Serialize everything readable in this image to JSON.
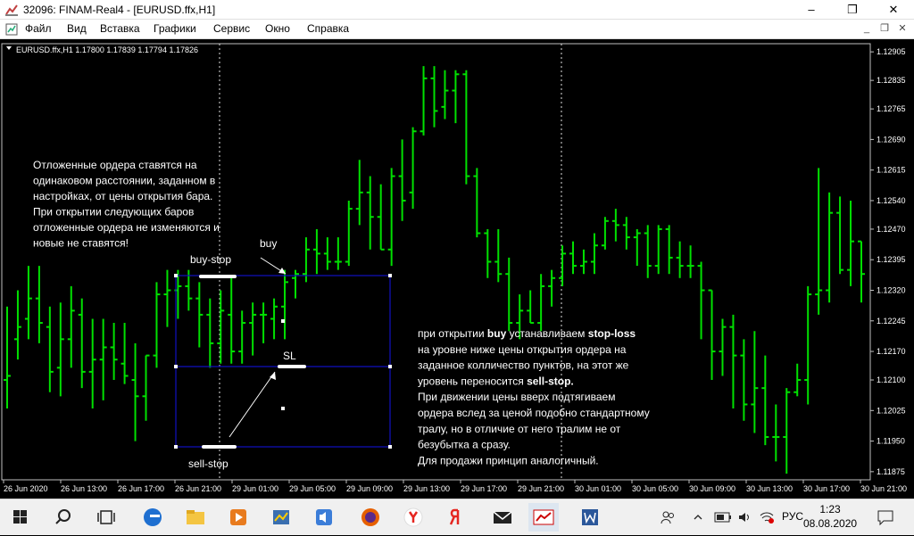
{
  "window": {
    "title": "32096: FINAM-Real4 - [EURUSD.ffx,H1]",
    "minimize": "–",
    "maximize": "❐",
    "close": "✕"
  },
  "menu": [
    "Файл",
    "Вид",
    "Вставка",
    "Графики",
    "Сервис",
    "Окно",
    "Справка"
  ],
  "mdi": {
    "minimize": "_",
    "restore": "❐",
    "close": "✕"
  },
  "chart": {
    "header": "EURUSD.ffx,H1  1.17800 1.17839 1.17794 1.17826",
    "price_labels": [
      "1.12905",
      "1.12835",
      "1.12765",
      "1.12690",
      "1.12615",
      "1.12540",
      "1.12470",
      "1.12395",
      "1.12320",
      "1.12245",
      "1.12170",
      "1.12100",
      "1.12025",
      "1.11950",
      "1.11875"
    ],
    "time_labels": [
      "26 Jun 2020",
      "26 Jun 13:00",
      "26 Jun 17:00",
      "26 Jun 21:00",
      "29 Jun 01:00",
      "29 Jun 05:00",
      "29 Jun 09:00",
      "29 Jun 13:00",
      "29 Jun 17:00",
      "29 Jun 21:00",
      "30 Jun 01:00",
      "30 Jun 05:00",
      "30 Jun 09:00",
      "30 Jun 13:00",
      "30 Jun 17:00",
      "30 Jun 21:00"
    ],
    "annotations": {
      "note_left": [
        "Отложенные ордера ставятся на",
        "одинаковом расстоянии, заданном в",
        "настройках,  от цены открытия бара.",
        "При открытии следующих баров",
        "отложенные ордера не изменяются и",
        "новые не ставятся!"
      ],
      "buy_stop": "buy-stop",
      "buy": "buy",
      "sl": "SL",
      "sell_stop": "sell-stop",
      "note_right": [
        [
          {
            "t": "при открытии "
          },
          {
            "t": "buy",
            "b": true
          },
          {
            "t": " устанавливаем "
          },
          {
            "t": "stop-loss",
            "b": true
          }
        ],
        [
          {
            "t": "на уровне ниже цены открытия ордера на"
          }
        ],
        [
          {
            "t": "заданное колличество пунктов, на этот же"
          }
        ],
        [
          {
            "t": "уровень переносится "
          },
          {
            "t": "sell-stop.",
            "b": true
          }
        ],
        [
          {
            "t": "При движении цены вверх подтягиваем"
          }
        ],
        [
          {
            "t": "ордера вслед за ценой  подобно стандартному"
          }
        ],
        [
          {
            "t": " тралу, но в отличие от него тралим не от"
          }
        ],
        [
          {
            "t": " безубытка а сразу."
          }
        ],
        [
          {
            "t": " Для продажи принцип аналогичный."
          }
        ]
      ]
    }
  },
  "chart_data": {
    "type": "ohlc",
    "symbol": "EURUSD.ffx",
    "timeframe": "H1",
    "ylim": [
      1.11855,
      1.12925
    ],
    "bars": [
      {
        "o": 1.121,
        "h": 1.1228,
        "l": 1.1203,
        "c": 1.1211
      },
      {
        "o": 1.122,
        "h": 1.1232,
        "l": 1.1215,
        "c": 1.1223
      },
      {
        "o": 1.1225,
        "h": 1.1238,
        "l": 1.122,
        "c": 1.123
      },
      {
        "o": 1.123,
        "h": 1.1238,
        "l": 1.1219,
        "c": 1.1224
      },
      {
        "o": 1.1223,
        "h": 1.1228,
        "l": 1.1207,
        "c": 1.1212
      },
      {
        "o": 1.1213,
        "h": 1.1229,
        "l": 1.1206,
        "c": 1.122
      },
      {
        "o": 1.122,
        "h": 1.1233,
        "l": 1.1213,
        "c": 1.1227
      },
      {
        "o": 1.1226,
        "h": 1.123,
        "l": 1.1208,
        "c": 1.1212
      },
      {
        "o": 1.1212,
        "h": 1.1225,
        "l": 1.1203,
        "c": 1.1215
      },
      {
        "o": 1.1215,
        "h": 1.1225,
        "l": 1.1205,
        "c": 1.1218
      },
      {
        "o": 1.1218,
        "h": 1.1224,
        "l": 1.121,
        "c": 1.1215
      },
      {
        "o": 1.1214,
        "h": 1.1224,
        "l": 1.1209,
        "c": 1.1211
      },
      {
        "o": 1.121,
        "h": 1.1219,
        "l": 1.1195,
        "c": 1.1206
      },
      {
        "o": 1.1206,
        "h": 1.1216,
        "l": 1.12,
        "c": 1.1216
      },
      {
        "o": 1.1216,
        "h": 1.1234,
        "l": 1.1213,
        "c": 1.1231
      },
      {
        "o": 1.1231,
        "h": 1.1237,
        "l": 1.1223,
        "c": 1.1232
      },
      {
        "o": 1.1232,
        "h": 1.1237,
        "l": 1.1225,
        "c": 1.1233
      },
      {
        "o": 1.1233,
        "h": 1.1237,
        "l": 1.1227,
        "c": 1.123
      },
      {
        "o": 1.123,
        "h": 1.1234,
        "l": 1.1218,
        "c": 1.1226
      },
      {
        "o": 1.1226,
        "h": 1.123,
        "l": 1.1213,
        "c": 1.1219
      },
      {
        "o": 1.1219,
        "h": 1.1232,
        "l": 1.1214,
        "c": 1.1227
      },
      {
        "o": 1.1226,
        "h": 1.1235,
        "l": 1.1214,
        "c": 1.1217
      },
      {
        "o": 1.1217,
        "h": 1.1227,
        "l": 1.1214,
        "c": 1.1224
      },
      {
        "o": 1.1224,
        "h": 1.1229,
        "l": 1.1216,
        "c": 1.1226
      },
      {
        "o": 1.1226,
        "h": 1.1229,
        "l": 1.1219,
        "c": 1.1226
      },
      {
        "o": 1.1225,
        "h": 1.123,
        "l": 1.122,
        "c": 1.1228
      },
      {
        "o": 1.1228,
        "h": 1.1237,
        "l": 1.122,
        "c": 1.1234
      },
      {
        "o": 1.1235,
        "h": 1.1237,
        "l": 1.123,
        "c": 1.1236
      },
      {
        "o": 1.1236,
        "h": 1.1245,
        "l": 1.1234,
        "c": 1.1242
      },
      {
        "o": 1.1242,
        "h": 1.1247,
        "l": 1.1236,
        "c": 1.1241
      },
      {
        "o": 1.1241,
        "h": 1.1245,
        "l": 1.1237,
        "c": 1.1239
      },
      {
        "o": 1.1239,
        "h": 1.1245,
        "l": 1.1237,
        "c": 1.1239
      },
      {
        "o": 1.1239,
        "h": 1.1254,
        "l": 1.1238,
        "c": 1.1252
      },
      {
        "o": 1.1252,
        "h": 1.1264,
        "l": 1.1248,
        "c": 1.1256
      },
      {
        "o": 1.1256,
        "h": 1.126,
        "l": 1.1242,
        "c": 1.125
      },
      {
        "o": 1.125,
        "h": 1.1258,
        "l": 1.1242,
        "c": 1.1242
      },
      {
        "o": 1.1242,
        "h": 1.1262,
        "l": 1.1238,
        "c": 1.126
      },
      {
        "o": 1.126,
        "h": 1.1269,
        "l": 1.1249,
        "c": 1.1254
      },
      {
        "o": 1.1256,
        "h": 1.1272,
        "l": 1.1252,
        "c": 1.1271
      },
      {
        "o": 1.1271,
        "h": 1.1287,
        "l": 1.127,
        "c": 1.1284
      },
      {
        "o": 1.1284,
        "h": 1.1287,
        "l": 1.1272,
        "c": 1.1276
      },
      {
        "o": 1.1277,
        "h": 1.1286,
        "l": 1.1274,
        "c": 1.1281
      },
      {
        "o": 1.1281,
        "h": 1.1286,
        "l": 1.1273,
        "c": 1.1285
      },
      {
        "o": 1.1285,
        "h": 1.1286,
        "l": 1.1258,
        "c": 1.126
      },
      {
        "o": 1.126,
        "h": 1.1262,
        "l": 1.1245,
        "c": 1.1246
      },
      {
        "o": 1.1246,
        "h": 1.1247,
        "l": 1.1235,
        "c": 1.1239
      },
      {
        "o": 1.1239,
        "h": 1.1247,
        "l": 1.1234,
        "c": 1.1236
      },
      {
        "o": 1.1236,
        "h": 1.124,
        "l": 1.1222,
        "c": 1.1224
      },
      {
        "o": 1.1224,
        "h": 1.1231,
        "l": 1.122,
        "c": 1.1227
      },
      {
        "o": 1.1227,
        "h": 1.1232,
        "l": 1.1224,
        "c": 1.1224
      },
      {
        "o": 1.1224,
        "h": 1.1236,
        "l": 1.1222,
        "c": 1.1233
      },
      {
        "o": 1.1233,
        "h": 1.1237,
        "l": 1.1228,
        "c": 1.1235
      },
      {
        "o": 1.1235,
        "h": 1.1243,
        "l": 1.1233,
        "c": 1.1241
      },
      {
        "o": 1.1241,
        "h": 1.1244,
        "l": 1.1236,
        "c": 1.1238
      },
      {
        "o": 1.1238,
        "h": 1.1242,
        "l": 1.1236,
        "c": 1.1239
      },
      {
        "o": 1.1239,
        "h": 1.1246,
        "l": 1.1236,
        "c": 1.1243
      },
      {
        "o": 1.1243,
        "h": 1.125,
        "l": 1.1242,
        "c": 1.1249
      },
      {
        "o": 1.1249,
        "h": 1.1252,
        "l": 1.1244,
        "c": 1.1248
      },
      {
        "o": 1.1248,
        "h": 1.125,
        "l": 1.1242,
        "c": 1.1245
      },
      {
        "o": 1.1245,
        "h": 1.1247,
        "l": 1.1238,
        "c": 1.1246
      },
      {
        "o": 1.1246,
        "h": 1.1248,
        "l": 1.1235,
        "c": 1.1238
      },
      {
        "o": 1.1238,
        "h": 1.1248,
        "l": 1.1236,
        "c": 1.1247
      },
      {
        "o": 1.1247,
        "h": 1.1248,
        "l": 1.1236,
        "c": 1.124
      },
      {
        "o": 1.124,
        "h": 1.1244,
        "l": 1.1235,
        "c": 1.1238
      },
      {
        "o": 1.1238,
        "h": 1.1243,
        "l": 1.1235,
        "c": 1.1238
      },
      {
        "o": 1.1238,
        "h": 1.1239,
        "l": 1.122,
        "c": 1.1232
      },
      {
        "o": 1.1232,
        "h": 1.1232,
        "l": 1.121,
        "c": 1.1217
      },
      {
        "o": 1.1217,
        "h": 1.1225,
        "l": 1.1211,
        "c": 1.1223
      },
      {
        "o": 1.1223,
        "h": 1.1226,
        "l": 1.1203,
        "c": 1.1216
      },
      {
        "o": 1.1216,
        "h": 1.122,
        "l": 1.12,
        "c": 1.1204
      },
      {
        "o": 1.1204,
        "h": 1.1222,
        "l": 1.1197,
        "c": 1.1208
      },
      {
        "o": 1.1208,
        "h": 1.1216,
        "l": 1.1194,
        "c": 1.1196
      },
      {
        "o": 1.1196,
        "h": 1.1204,
        "l": 1.119,
        "c": 1.1196
      },
      {
        "o": 1.1196,
        "h": 1.1208,
        "l": 1.1187,
        "c": 1.1207
      },
      {
        "o": 1.1207,
        "h": 1.1214,
        "l": 1.1206,
        "c": 1.121
      },
      {
        "o": 1.121,
        "h": 1.1233,
        "l": 1.1204,
        "c": 1.1231
      },
      {
        "o": 1.1231,
        "h": 1.1262,
        "l": 1.1226,
        "c": 1.1232
      },
      {
        "o": 1.1232,
        "h": 1.1256,
        "l": 1.1229,
        "c": 1.1251
      },
      {
        "o": 1.1251,
        "h": 1.1255,
        "l": 1.1236,
        "c": 1.1237
      },
      {
        "o": 1.1237,
        "h": 1.1254,
        "l": 1.1233,
        "c": 1.1244
      },
      {
        "o": 1.1244,
        "h": 1.1244,
        "l": 1.1229,
        "c": 1.1236
      }
    ]
  },
  "taskbar": {
    "tray_lang": "РУС",
    "time": "1:23",
    "date": "08.08.2020"
  }
}
